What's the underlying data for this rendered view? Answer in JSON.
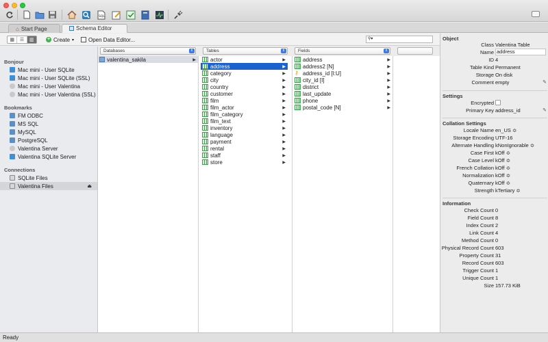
{
  "toolbar_icons": [
    "refresh-icon",
    "new-file-icon",
    "folder-icon",
    "save-icon",
    "home-icon",
    "search-icon",
    "sql-icon",
    "edit-icon",
    "check-icon",
    "book-icon",
    "activity-icon",
    "plug-icon"
  ],
  "tabs": [
    {
      "label": "Start Page",
      "icon": "home-icon"
    },
    {
      "label": "Schema Editor",
      "icon": "schema-icon"
    }
  ],
  "actions": {
    "create_label": "Create",
    "open_label": "Open Data Editor..."
  },
  "sidebar": {
    "sections": [
      {
        "title": "Bonjour",
        "items": [
          "Mac mini - User SQLite",
          "Mac mini - User SQLite (SSL)",
          "Mac mini - User Valentina",
          "Mac mini - User Valentina (SSL)"
        ]
      },
      {
        "title": "Bookmarks",
        "items": [
          "FM ODBC",
          "MS SQL",
          "MySQL",
          "PostgreSQL",
          "Valentina Server",
          "Valentina SQLite Server"
        ]
      },
      {
        "title": "Connections",
        "items": [
          "SQLite Files",
          "Valentina Files"
        ]
      }
    ]
  },
  "columns": {
    "databases": {
      "header": "Databases",
      "items": [
        "valentina_sakila"
      ]
    },
    "tables": {
      "header": "Tables",
      "items": [
        "actor",
        "address",
        "category",
        "city",
        "country",
        "customer",
        "film",
        "film_actor",
        "film_category",
        "film_text",
        "inventory",
        "language",
        "payment",
        "rental",
        "staff",
        "store"
      ],
      "selected": "address"
    },
    "fields": {
      "header": "Fields",
      "items": [
        "address",
        "address2 [N]",
        "address_id [I:U]",
        "city_id [I]",
        "district",
        "last_update",
        "phone",
        "postal_code [N]"
      ]
    }
  },
  "object_panel": {
    "object_title": "Object",
    "object": [
      {
        "k": "Class",
        "v": "Valentina Table"
      },
      {
        "k": "Name",
        "v": "address"
      },
      {
        "k": "ID",
        "v": "4"
      },
      {
        "k": "Table Kind",
        "v": "Permanent"
      },
      {
        "k": "Storage",
        "v": "On disk"
      },
      {
        "k": "Comment",
        "v": "empty"
      }
    ],
    "settings_title": "Settings",
    "settings": [
      {
        "k": "Encrypted",
        "v": ""
      },
      {
        "k": "Primary Key",
        "v": "address_id"
      }
    ],
    "collation_title": "Collation Settings",
    "collation": [
      {
        "k": "Locale Name",
        "v": "en_US ≎"
      },
      {
        "k": "Storage Encoding",
        "v": "UTF-16"
      },
      {
        "k": "Alternate Handling",
        "v": "kNonIgnorable ≎"
      },
      {
        "k": "Case First",
        "v": "kOff ≎"
      },
      {
        "k": "Case Level",
        "v": "kOff ≎"
      },
      {
        "k": "French Collation",
        "v": "kOff ≎"
      },
      {
        "k": "Normalization",
        "v": "kOff ≎"
      },
      {
        "k": "Quaternary",
        "v": "kOff ≎"
      },
      {
        "k": "Strength",
        "v": "kTertiary ≎"
      }
    ],
    "information_title": "Information",
    "information": [
      {
        "k": "Check Count",
        "v": "0"
      },
      {
        "k": "Field Count",
        "v": "8"
      },
      {
        "k": "Index Count",
        "v": "2"
      },
      {
        "k": "Link Count",
        "v": "4"
      },
      {
        "k": "Method Count",
        "v": "0"
      },
      {
        "k": "Physical Record Count",
        "v": "603"
      },
      {
        "k": "Property Count",
        "v": "31"
      },
      {
        "k": "Record Count",
        "v": "603"
      },
      {
        "k": "Trigger Count",
        "v": "1"
      },
      {
        "k": "Unique Count",
        "v": "1"
      },
      {
        "k": "Size",
        "v": "157.73 KiB"
      }
    ]
  },
  "status": "Ready"
}
